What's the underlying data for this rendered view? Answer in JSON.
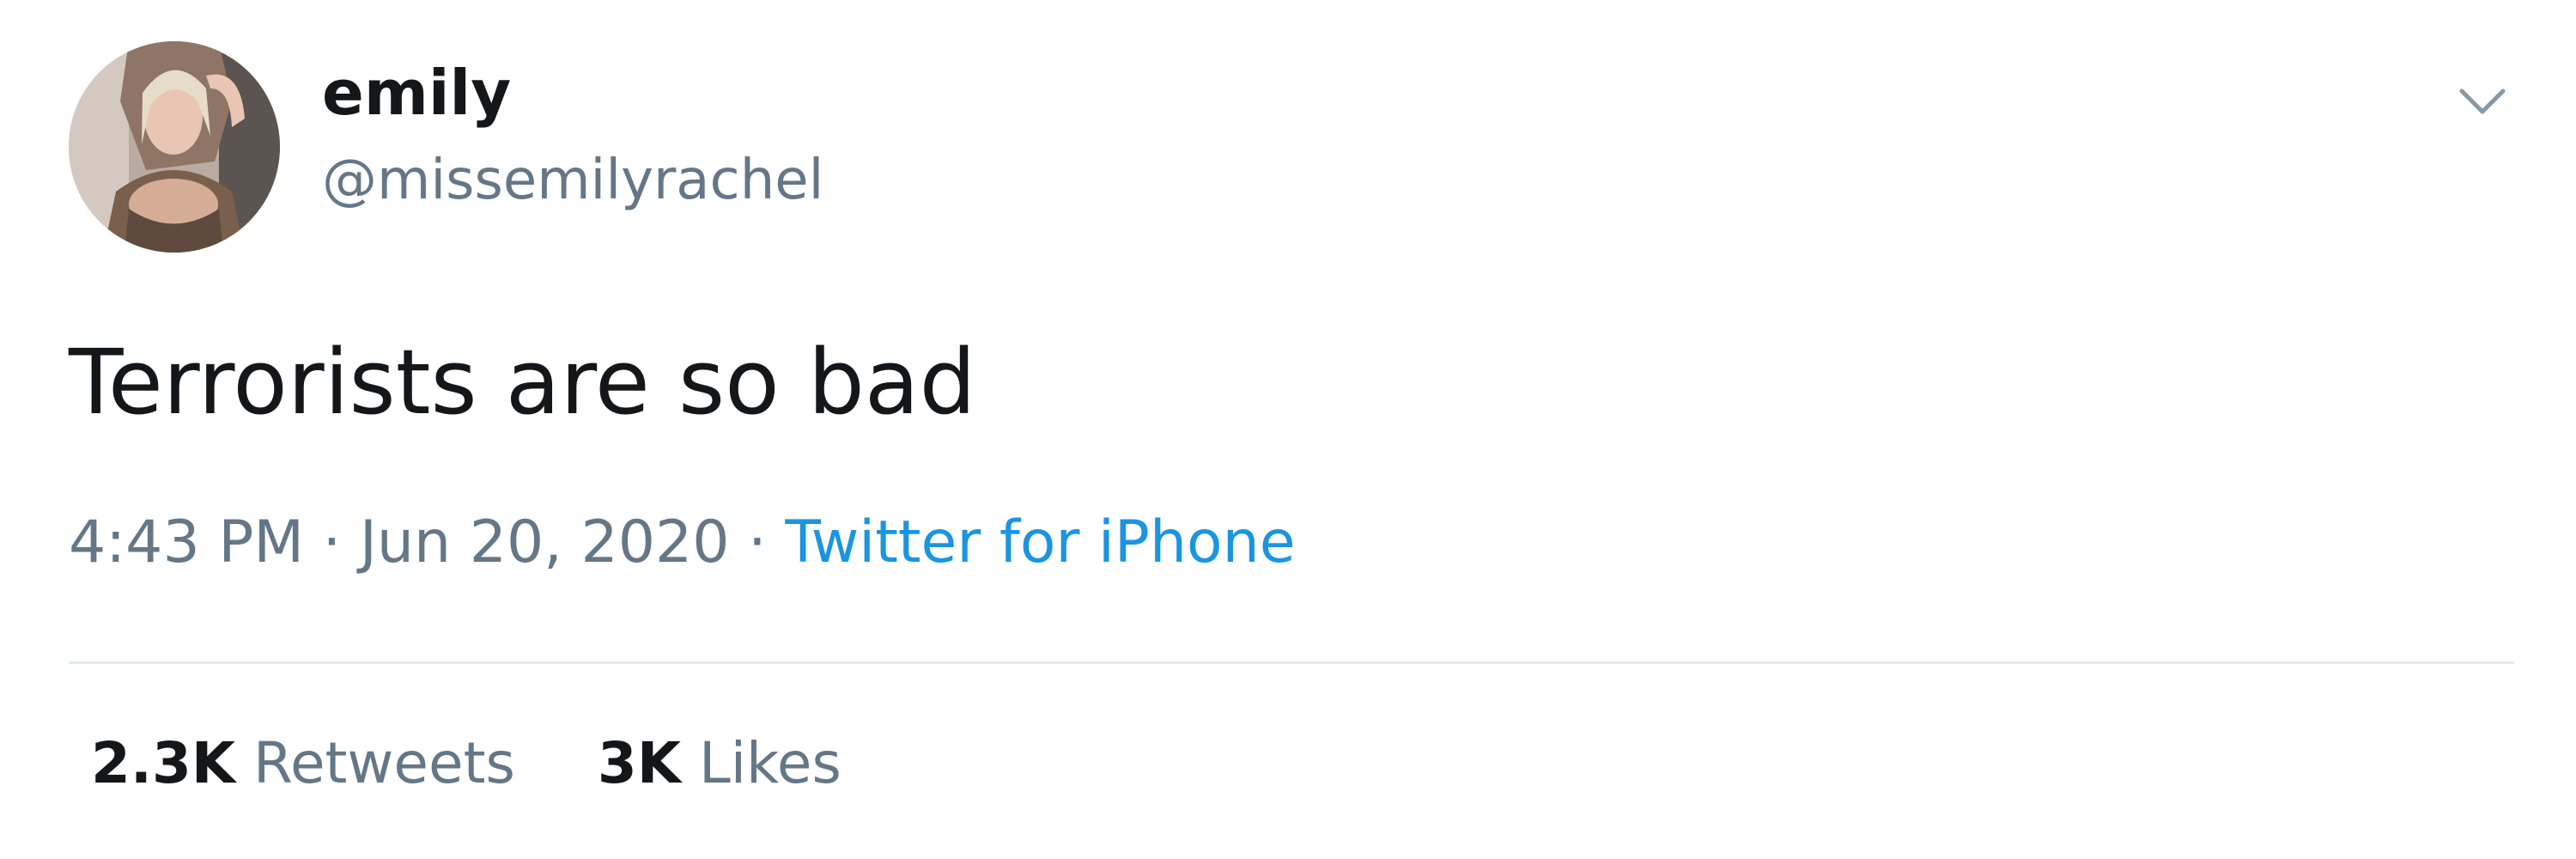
{
  "user": {
    "display_name": "emily",
    "handle": "@missemilyrachel",
    "avatar_icon": "profile-photo"
  },
  "tweet": {
    "text": "Terrorists are so bad",
    "time": "4:43 PM",
    "separator": " · ",
    "date": "Jun 20, 2020",
    "source": "Twitter for iPhone"
  },
  "stats": {
    "retweets_count": "2.3K",
    "retweets_label": "Retweets",
    "likes_count": "3K",
    "likes_label": "Likes"
  },
  "menu": {
    "icon": "chevron-down-icon"
  },
  "colors": {
    "text_primary": "#14171a",
    "text_secondary": "#657786",
    "link": "#1b95e0",
    "divider": "#e1e8ed",
    "background": "#ffffff"
  }
}
